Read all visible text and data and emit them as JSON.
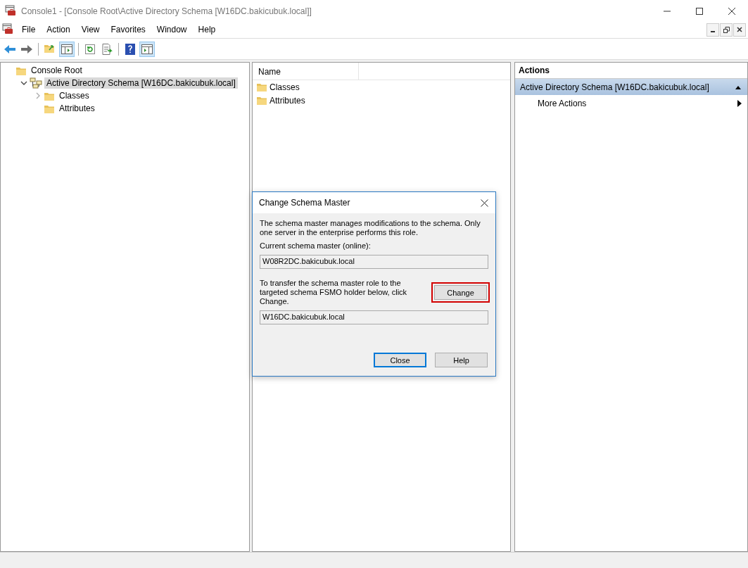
{
  "window": {
    "title": "Console1 - [Console Root\\Active Directory Schema [W16DC.bakicubuk.local]]"
  },
  "menu": [
    "File",
    "Action",
    "View",
    "Favorites",
    "Window",
    "Help"
  ],
  "toolbar": [
    {
      "kind": "back",
      "pressed": false
    },
    {
      "kind": "forward",
      "pressed": false
    },
    {
      "kind": "sep"
    },
    {
      "kind": "up",
      "pressed": false
    },
    {
      "kind": "tree",
      "pressed": true
    },
    {
      "kind": "sep"
    },
    {
      "kind": "refresh",
      "pressed": false
    },
    {
      "kind": "export",
      "pressed": false
    },
    {
      "kind": "sep"
    },
    {
      "kind": "help",
      "pressed": false
    },
    {
      "kind": "actionpane",
      "pressed": true
    }
  ],
  "tree": [
    {
      "label": "Console Root",
      "kind": "folder",
      "selected": false,
      "children": [
        {
          "label": "Active Directory Schema [W16DC.bakicubuk.local]",
          "kind": "snapin",
          "expanded": true,
          "selected": true,
          "children": [
            {
              "label": "Classes",
              "kind": "folder",
              "expanded": false,
              "selected": false
            },
            {
              "label": "Attributes",
              "kind": "folder",
              "selected": false
            }
          ]
        }
      ]
    }
  ],
  "list": {
    "columns": [
      "Name"
    ],
    "items": [
      "Classes",
      "Attributes"
    ]
  },
  "actions": {
    "header": "Actions",
    "group": {
      "title": "Active Directory Schema [W16DC.bakicubuk.local]",
      "expanded": true
    },
    "items": [
      {
        "label": "More Actions",
        "submenu": true
      }
    ]
  },
  "dialog": {
    "title": "Change Schema Master",
    "description": "The schema master manages modifications to the schema. Only one server in the enterprise performs this role.",
    "current_label": "Current schema master (online):",
    "current_value": "W08R2DC.bakicubuk.local",
    "transfer_text": "To transfer the schema master role to the targeted schema FSMO holder below, click Change.",
    "change_button": {
      "label": "Change",
      "highlighted": true
    },
    "target_value": "W16DC.bakicubuk.local",
    "buttons": [
      {
        "label": "Close",
        "default": true
      },
      {
        "label": "Help",
        "default": false
      }
    ]
  }
}
